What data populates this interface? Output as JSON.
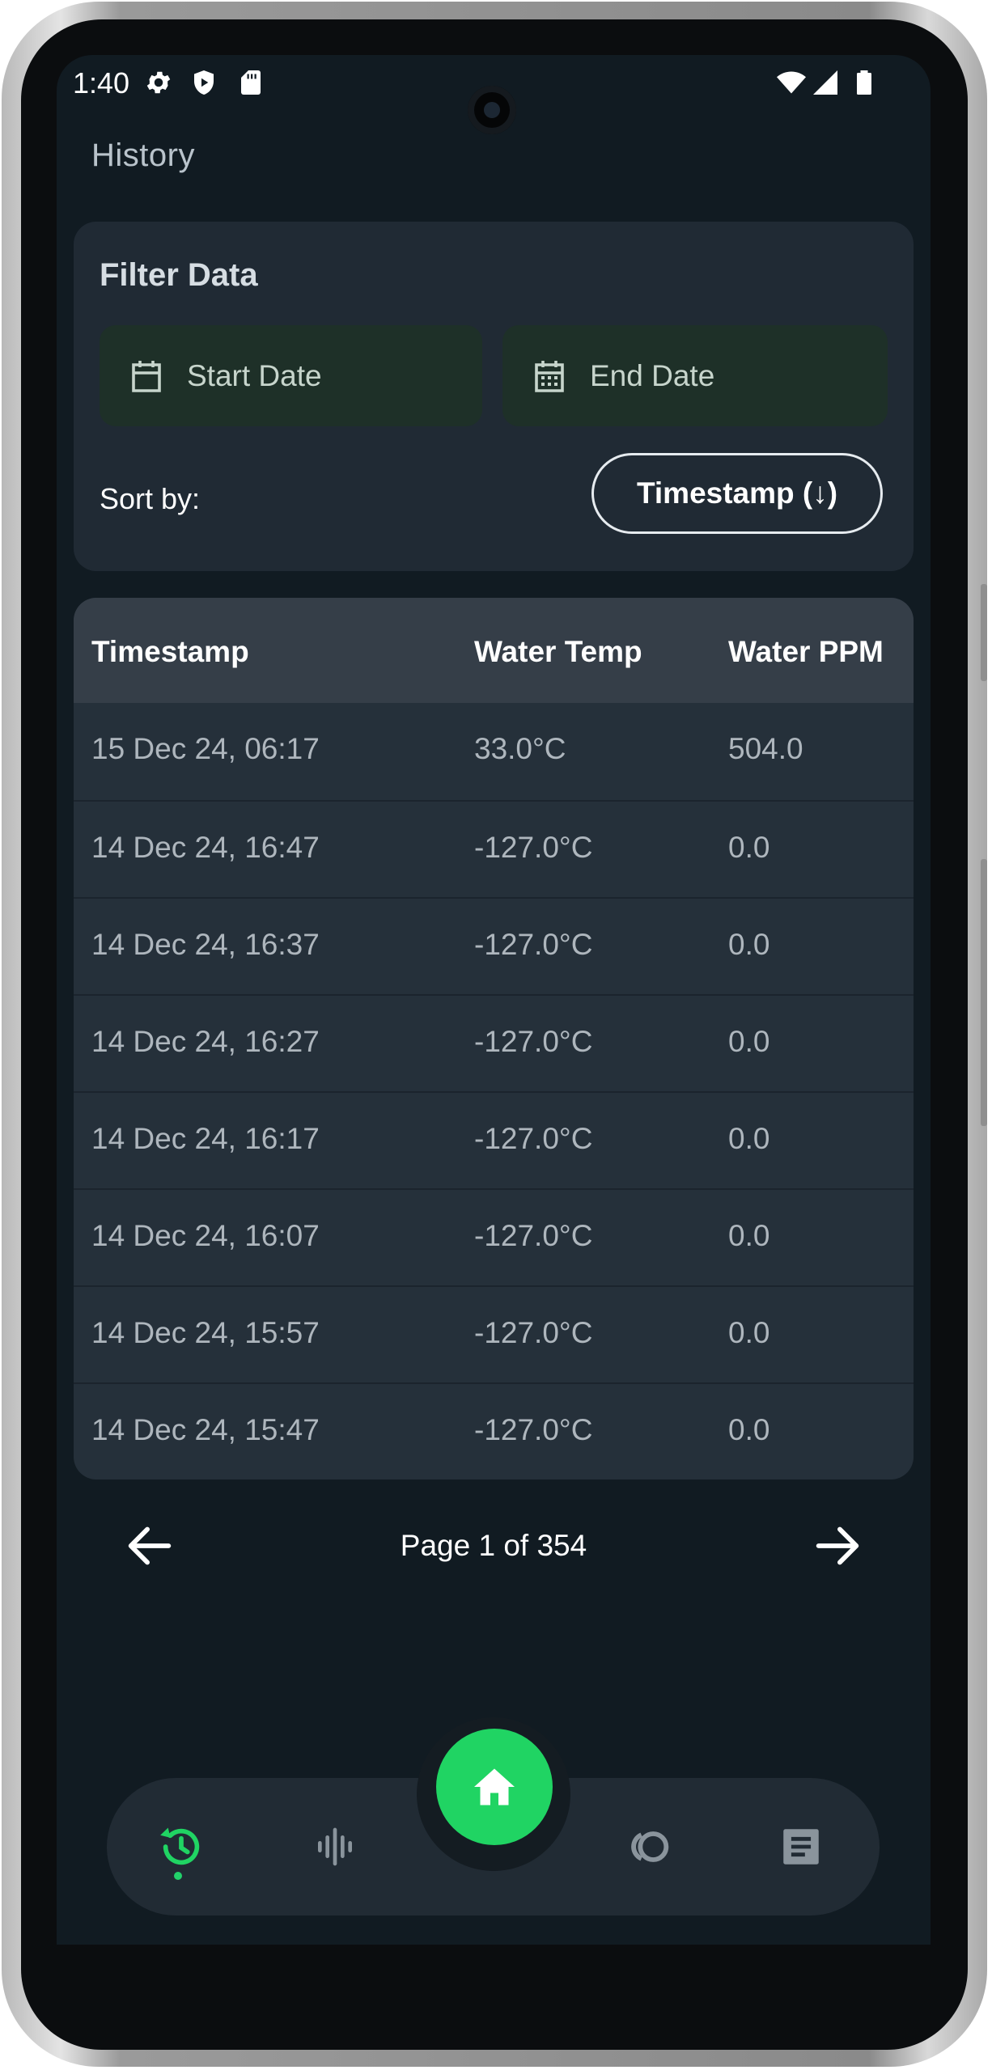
{
  "status_bar": {
    "time": "1:40",
    "left_icons": [
      "gear-icon",
      "shield-play-icon",
      "sd-card-icon"
    ],
    "right_icons": [
      "wifi-icon",
      "signal-icon",
      "battery-icon"
    ]
  },
  "page": {
    "title": "History"
  },
  "filter": {
    "title": "Filter Data",
    "start_date_label": "Start Date",
    "end_date_label": "End Date",
    "sort_label": "Sort by:",
    "sort_value": "Timestamp (↓)"
  },
  "table": {
    "headers": [
      "Timestamp",
      "Water Temp",
      "Water PPM"
    ],
    "rows": [
      [
        "15 Dec 24, 06:17",
        "33.0°C",
        "504.0"
      ],
      [
        "14 Dec 24, 16:47",
        "-127.0°C",
        "0.0"
      ],
      [
        "14 Dec 24, 16:37",
        "-127.0°C",
        "0.0"
      ],
      [
        "14 Dec 24, 16:27",
        "-127.0°C",
        "0.0"
      ],
      [
        "14 Dec 24, 16:17",
        "-127.0°C",
        "0.0"
      ],
      [
        "14 Dec 24, 16:07",
        "-127.0°C",
        "0.0"
      ],
      [
        "14 Dec 24, 15:57",
        "-127.0°C",
        "0.0"
      ],
      [
        "14 Dec 24, 15:47",
        "-127.0°C",
        "0.0"
      ]
    ]
  },
  "pagination": {
    "text": "Page 1 of 354"
  },
  "bottom_nav": {
    "items": [
      "history-icon",
      "waveform-icon",
      "home-icon",
      "toggle-icon",
      "notes-icon"
    ],
    "active": "history-icon",
    "accent_color": "#20d463"
  }
}
